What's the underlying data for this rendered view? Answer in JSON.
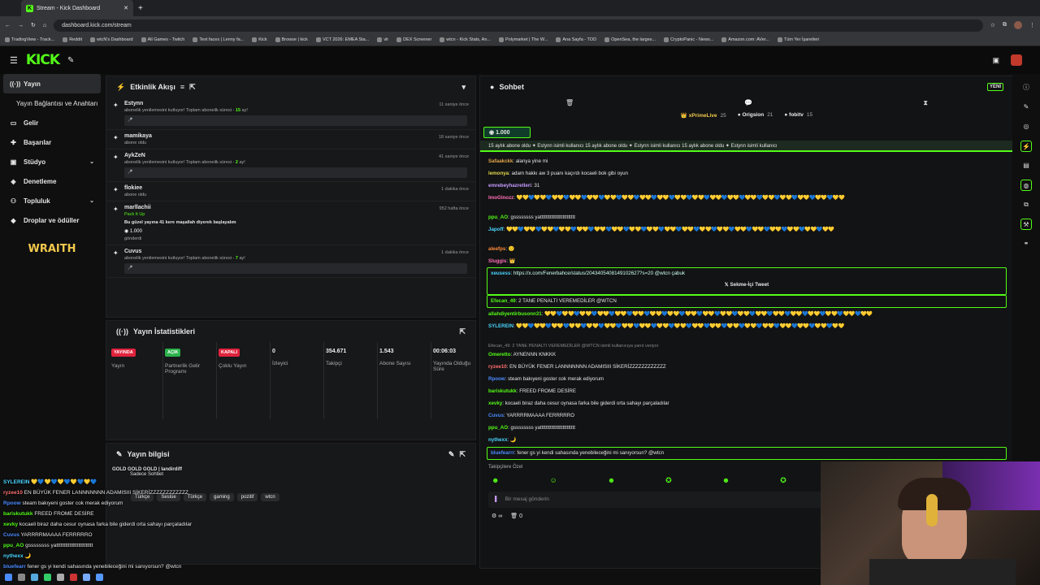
{
  "browser": {
    "tab_title": "Stream - Kick Dashboard",
    "url": "dashboard.kick.com/stream",
    "bookmarks": [
      "TradingView - Track...",
      "Reddit",
      "wtcN's Dashboard",
      "All Games - Twitch",
      "Text faces | Lenny fa...",
      "Kick",
      "Browse | kick",
      "VCT 2026: EMEA Sta...",
      "vlr",
      "DEX Screener",
      "wtcn - Kick Stats, An...",
      "Polymarket | The W...",
      "Ana Sayfa - TOD",
      "OpenSea, the larges...",
      "CryptoPanic - News...",
      "Amazon.com: AVer...",
      "Tüm Yer İşaretleri"
    ]
  },
  "kick": {
    "logo": "KICK"
  },
  "sidebar": {
    "items": [
      {
        "label": "Yayın",
        "icon": "broadcast-icon"
      },
      {
        "label": "Yayın Bağlantısı ve Anahtarı",
        "icon": ""
      },
      {
        "label": "Gelir",
        "icon": "wallet-icon"
      },
      {
        "label": "Başarılar",
        "icon": "trophy-icon"
      },
      {
        "label": "Stüdyo",
        "icon": "studio-icon"
      },
      {
        "label": "Denetleme",
        "icon": "shield-icon"
      },
      {
        "label": "Topluluk",
        "icon": "community-icon"
      },
      {
        "label": "Droplar ve ödüller",
        "icon": "gift-icon"
      }
    ],
    "sponsor": "WRAITH"
  },
  "activity": {
    "title": "Etkinlik Akışı",
    "events": [
      {
        "name": "Estynn",
        "time": "11 saniye önce",
        "desc_pre": "abonelik yenilemesini kutluyor! Toplam abonelik süresi - ",
        "desc_num": "15",
        "desc_post": " ay!",
        "box": true
      },
      {
        "name": "mamikaya",
        "time": "18 saniye önce",
        "desc_pre": "abone oldu",
        "desc_num": "",
        "desc_post": "",
        "box": false
      },
      {
        "name": "AykZeN",
        "time": "41 saniye önce",
        "desc_pre": "abonelik yenilemesini kutluyor! Toplam abonelik süresi - ",
        "desc_num": "2",
        "desc_post": " ay!",
        "box": true
      },
      {
        "name": "flokiee",
        "time": "1 dakika önce",
        "desc_pre": "abone oldu",
        "desc_num": "",
        "desc_post": "",
        "box": false
      },
      {
        "name": "marllachii",
        "time": "952 hafta önce",
        "desc_pre": "Pack It Up",
        "desc_num": "",
        "desc_post": "",
        "box": false
      },
      {
        "name": "Cuvus",
        "time": "1 dakika önce",
        "desc_pre": "abonelik yenilemesini kutluyor! Toplam abonelik süresi - ",
        "desc_num": "7",
        "desc_post": " ay!",
        "box": true
      }
    ],
    "kicks_msg": "Bu güzel yayına 41 kere maşallah diyerek başlayalım",
    "kicks_amount": "1.000",
    "kicks_sent": "gönderdi"
  },
  "stats": {
    "title": "Yayın İstatistikleri",
    "items": [
      {
        "badge": "YAYINDA",
        "badge_color": "#e0233d",
        "label": "Yayın"
      },
      {
        "badge": "AÇIK",
        "badge_color": "#2bb24c",
        "label": "Partnerlik Gelir Programı"
      },
      {
        "badge": "KAPALI",
        "badge_color": "#e0233d",
        "label": "Çoklu Yayın"
      },
      {
        "value": "0",
        "label": "İzleyici"
      },
      {
        "value": "354.671",
        "label": "Takipçi"
      },
      {
        "value": "1.543",
        "label": "Abone Sayısı"
      },
      {
        "value": "00:06:03",
        "label": "Yayında Olduğu Süre"
      }
    ]
  },
  "info": {
    "title": "Yayın bilgisi",
    "tags": [
      "Türkçe",
      "Seslüe",
      "Türkçe",
      "gaming",
      "pozitif",
      "wtcn"
    ]
  },
  "chat": {
    "title": "Sohbet",
    "new_label": "YENİ",
    "top": [
      {
        "name": "xPrimeLive",
        "val": "25"
      },
      {
        "name": "Origsion",
        "val": "21"
      },
      {
        "name": "fobitv",
        "val": "15"
      }
    ],
    "goal": "1.000",
    "ticker": "15 aylık abone oldu ✦ Estynn isimli kullanıcı 15 aylık abone oldu ✦ Estynn isimli kullanıcı 15 aylık abone oldu ✦ Estynn isimli kullanıcı",
    "messages": [
      {
        "u": "Safaakckk",
        "c": "#e3a64c",
        "t": "alanya yine mi"
      },
      {
        "u": "lemonya",
        "c": "#e3d84c",
        "t": "adam hakkı aw 3 puanı kaçırdı kocaeli bok gibi oyun"
      },
      {
        "u": "emrebeyhazretleri",
        "c": "#c79bff",
        "t": "31"
      },
      {
        "u": "ImoGlnozz",
        "c": "#ff6fb5",
        "t": "hearts"
      },
      {
        "u": "ppu_AO",
        "c": "#53fc18",
        "t": "gssssssss yattttttttttttttttttttttttt"
      },
      {
        "u": "Japoff",
        "c": "#4ad6ff",
        "t": "hearts"
      },
      {
        "u": "aleefps",
        "c": "#ff8c3b",
        "t": "🙂"
      },
      {
        "u": "Sluggis",
        "c": "#ff6fb5",
        "t": "👑"
      },
      {
        "u": "xeusess",
        "c": "#4ad6ff",
        "t": "https://x.com/Fenerbahce/status/2043405408149102627?s=20 @wtcn çabuk"
      },
      {
        "u": "Efecan_49",
        "c": "#53fc18",
        "t": "2 TANE PENALTI VEREMEDİLER @WTCN"
      },
      {
        "u": "allahdiyentirbusonn31",
        "c": "#53fc18",
        "t": "hearts"
      },
      {
        "u": "SYLEREIN",
        "c": "#4ad6ff",
        "t": "hearts"
      },
      {
        "u": "Omeretto",
        "c": "#53fc18",
        "t": "AYNENNN KNKKK"
      },
      {
        "u": "ryzee10",
        "c": "#ff6f6f",
        "t": "EN BÜYÜK FENER LANNNNNNN ADAMISIII SİKERİZZZZZZZZZZZZ"
      },
      {
        "u": "Rpoow",
        "c": "#4a8bff",
        "t": "steam bakıyeni goster cok merak ediyorum"
      },
      {
        "u": "bariskutukk",
        "c": "#53fc18",
        "t": "FREED FROME DESİRE"
      },
      {
        "u": "xevky",
        "c": "#53fc18",
        "t": "kocaeli biraz daha cesur oynasa farka bile giderdi orta sahayı parçaladılar"
      },
      {
        "u": "Cuvus",
        "c": "#4a8bff",
        "t": "YARRRRMAAAA FERRRRRO"
      },
      {
        "u": "ppu_AO",
        "c": "#53fc18",
        "t": "gssssssss yattttttttttttttttttttttttt"
      },
      {
        "u": "nythexx",
        "c": "#4ad6ff",
        "t": "🌙"
      },
      {
        "u": "bluefearrr",
        "c": "#4a8bff",
        "t": "fener gs yi kendi sahasında yenebileceğini mi sanıyorsun? @wtcn"
      }
    ],
    "tweet_label": "Sekme-İçi Tweet",
    "reply_note": "Efecan_49: 2 TANE PENALTI VEREMEDİLER @WTCN isimli kullanıcıya yanıt veriyor",
    "followers_only": "Takipçilere Özel",
    "input_placeholder": "Bir mesaj gönderin",
    "footer_count": "0"
  },
  "overlay": {
    "lines": [
      {
        "u": "SYLEREIN",
        "c": "#4ad6ff",
        "t": "💛💙💛💙💛💙💛💙💛💙"
      },
      {
        "u": "ryzee10",
        "c": "#ff6f6f",
        "t": "EN BÜYÜK FENER LANNNNNNN ADAMISIII SİKERİZZZZZZZZZZZZ"
      },
      {
        "u": "Rpoow",
        "c": "#4a8bff",
        "t": "steam bakıyeni goster cok merak ediyorum"
      },
      {
        "u": "bariskutukk",
        "c": "#53fc18",
        "t": "FREED FROME DESİRE"
      },
      {
        "u": "xevky",
        "c": "#53fc18",
        "t": "kocaeli biraz daha cesur oynasa farka bile giderdi orta sahayı parçaladılar"
      },
      {
        "u": "Cuvus",
        "c": "#4a8bff",
        "t": "YARRRRMAAAA FERRRRRO"
      },
      {
        "u": "ppu_AO",
        "c": "#53fc18",
        "t": "gssssssss yattttttttttttttttttttttttt"
      },
      {
        "u": "nythexx",
        "c": "#4ad6ff",
        "t": "🌙"
      },
      {
        "u": "bluefearr",
        "c": "#4a8bff",
        "t": "fener gs yi kendi sahasında yenebileceğini mi sanıyorsun? @wtcn"
      }
    ],
    "goal_text": "GOLD GOLD GOLD | Iandirdiff",
    "chat_only": "Sadece Sohbet"
  }
}
